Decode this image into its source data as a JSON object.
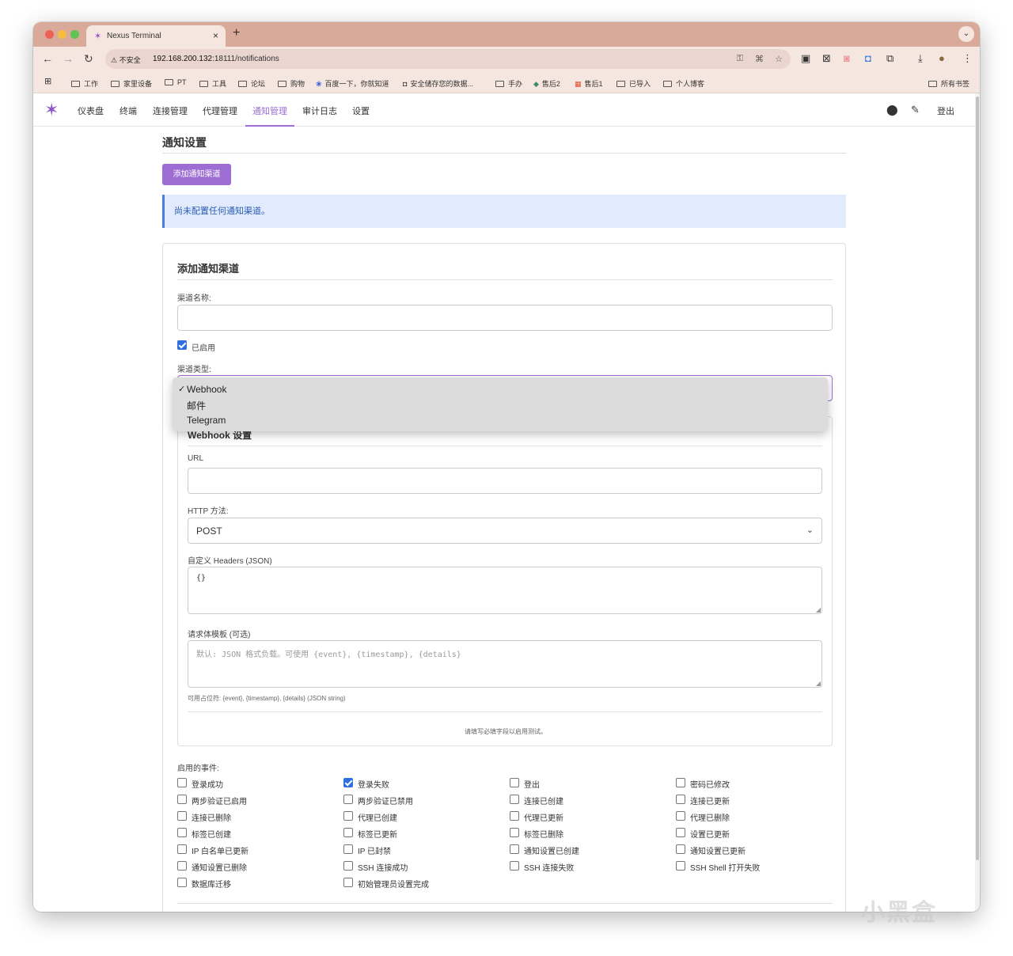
{
  "browser": {
    "tab_title": "Nexus Terminal",
    "tab_close": "×",
    "new_tab": "+",
    "tab_menu": "⌄",
    "security_label": "⚠ 不安全",
    "url_host": "192.168.200.132",
    "url_rest": ":18111/notifications"
  },
  "bookmarks": [
    {
      "label": "工作"
    },
    {
      "label": "家里设备"
    },
    {
      "label": "PT"
    },
    {
      "label": "工具"
    },
    {
      "label": "论坛"
    },
    {
      "label": "购物"
    },
    {
      "label": "百度一下，你就知道"
    },
    {
      "label": "安全储存您的数据..."
    },
    {
      "label": "手办"
    },
    {
      "label": "售后2"
    },
    {
      "label": "售后1"
    },
    {
      "label": "已导入"
    },
    {
      "label": "个人博客"
    },
    {
      "label": "所有书签"
    }
  ],
  "nav": {
    "items": [
      "仪表盘",
      "终端",
      "连接管理",
      "代理管理",
      "通知管理",
      "审计日志",
      "设置"
    ],
    "active": "通知管理",
    "logout": "登出"
  },
  "page": {
    "title": "通知设置",
    "add_button": "添加通知渠道",
    "empty_alert": "尚未配置任何通知渠道。"
  },
  "form": {
    "title": "添加通知渠道",
    "name_label": "渠道名称:",
    "name_value": "",
    "enabled_label": "已启用",
    "enabled": true,
    "type_label": "渠道类型:",
    "type_options": [
      "Webhook",
      "邮件",
      "Telegram"
    ],
    "type_selected": "Webhook",
    "webhook": {
      "title": "Webhook 设置",
      "url_label": "URL",
      "url_value": "",
      "method_label": "HTTP 方法:",
      "method_value": "POST",
      "headers_label": "自定义 Headers (JSON)",
      "headers_value": "{}",
      "body_label": "请求体模板 (可选)",
      "body_placeholder": "默认: JSON 格式负载。可使用 {event}, {timestamp}, {details}",
      "placeholders_help": "可用占位符: {event}, {timestamp}, {details} (JSON string)",
      "test_note": "请填写必填字段以启用测试。"
    },
    "events_label": "启用的事件:",
    "events": [
      {
        "label": "登录成功",
        "checked": false
      },
      {
        "label": "登录失败",
        "checked": true
      },
      {
        "label": "登出",
        "checked": false
      },
      {
        "label": "密码已修改",
        "checked": false
      },
      {
        "label": "两步验证已启用",
        "checked": false
      },
      {
        "label": "两步验证已禁用",
        "checked": false
      },
      {
        "label": "连接已创建",
        "checked": false
      },
      {
        "label": "连接已更新",
        "checked": false
      },
      {
        "label": "连接已删除",
        "checked": false
      },
      {
        "label": "代理已创建",
        "checked": false
      },
      {
        "label": "代理已更新",
        "checked": false
      },
      {
        "label": "代理已删除",
        "checked": false
      },
      {
        "label": "标签已创建",
        "checked": false
      },
      {
        "label": "标签已更新",
        "checked": false
      },
      {
        "label": "标签已删除",
        "checked": false
      },
      {
        "label": "设置已更新",
        "checked": false
      },
      {
        "label": "IP 白名单已更新",
        "checked": false
      },
      {
        "label": "IP 已封禁",
        "checked": false
      },
      {
        "label": "通知设置已创建",
        "checked": false
      },
      {
        "label": "通知设置已更新",
        "checked": false
      },
      {
        "label": "通知设置已删除",
        "checked": false
      },
      {
        "label": "SSH 连接成功",
        "checked": false
      },
      {
        "label": "SSH 连接失败",
        "checked": false
      },
      {
        "label": "SSH Shell 打开失败",
        "checked": false
      },
      {
        "label": "数据库迁移",
        "checked": false
      },
      {
        "label": "初始管理员设置完成",
        "checked": false
      }
    ]
  },
  "watermark": "小黑盒",
  "colors": {
    "accent": "#9d6dd4",
    "tabstrip": "#d9aa99",
    "alert_bg": "#e1ebfd",
    "checkbox_checked": "#2f6fe0"
  }
}
